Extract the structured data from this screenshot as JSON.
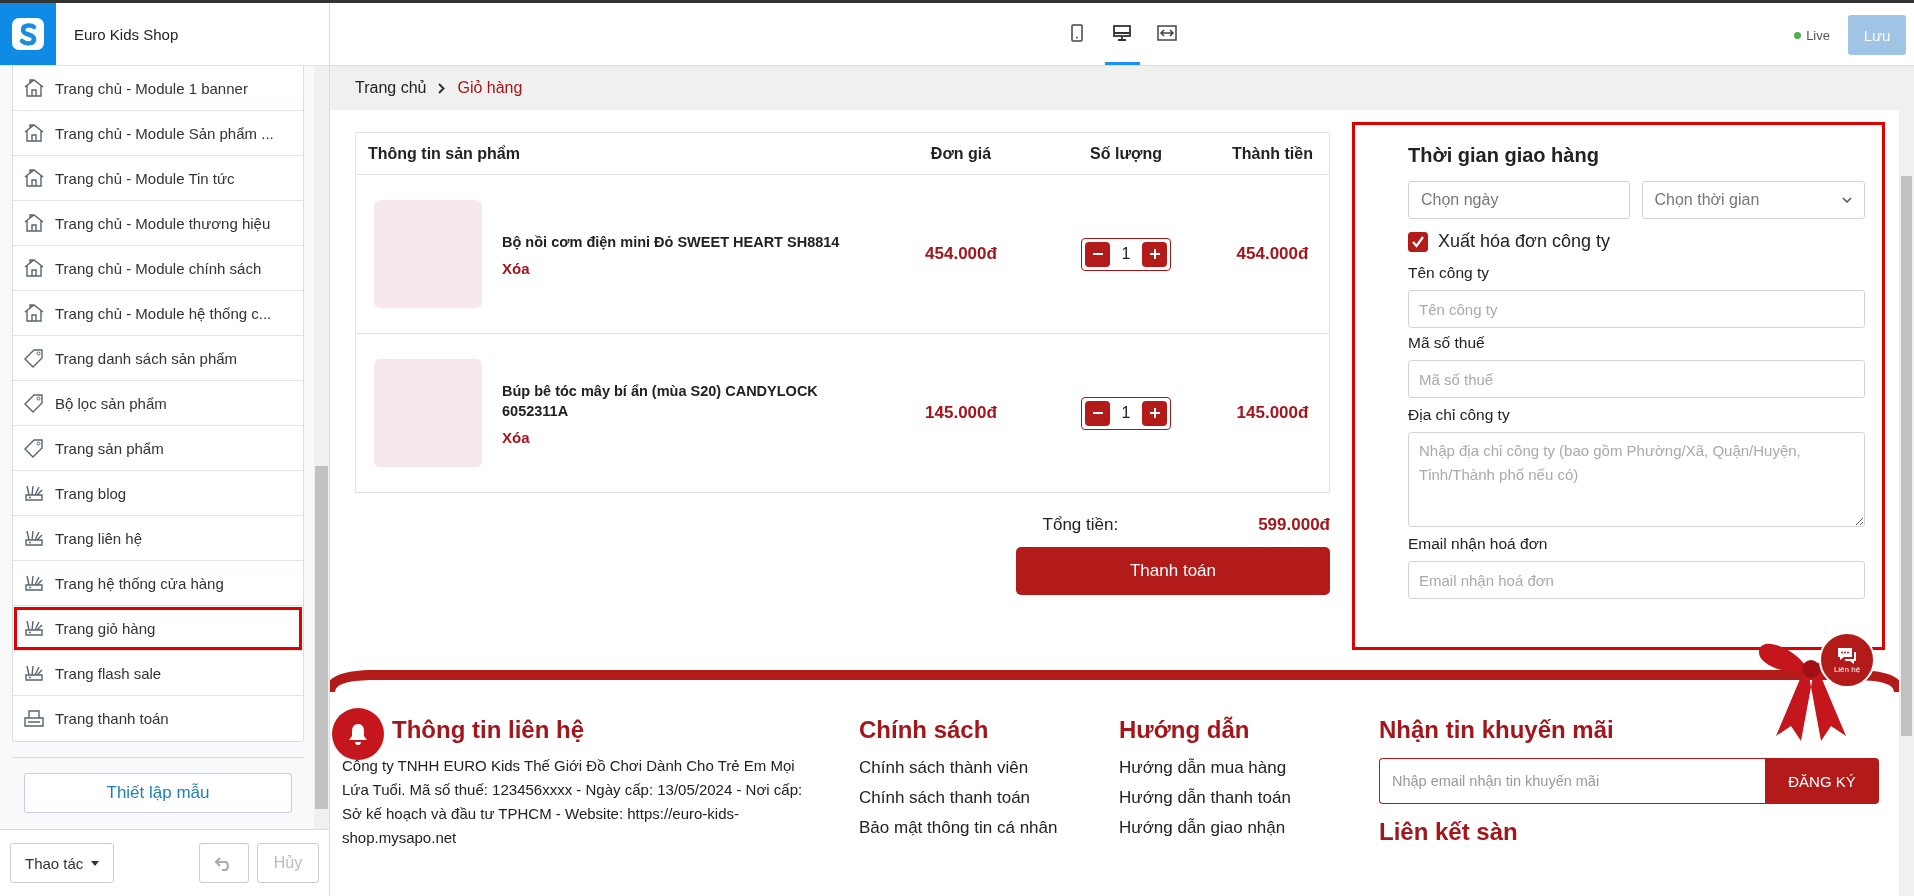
{
  "app": {
    "shop_name": "Euro Kids Shop"
  },
  "sidebar": {
    "items": [
      {
        "label": "Trang chủ - Module 1 banner",
        "kind": "home",
        "highlighted": false
      },
      {
        "label": "Trang chủ - Module Sản phẩm ...",
        "kind": "home",
        "highlighted": false
      },
      {
        "label": "Trang chủ - Module Tin tức",
        "kind": "home",
        "highlighted": false
      },
      {
        "label": "Trang chủ - Module thương hiệu",
        "kind": "home",
        "highlighted": false
      },
      {
        "label": "Trang chủ - Module chính sách",
        "kind": "home",
        "highlighted": false
      },
      {
        "label": "Trang chủ - Module hệ thống c...",
        "kind": "home",
        "highlighted": false
      },
      {
        "label": "Trang danh sách sản phẩm",
        "kind": "tag",
        "highlighted": false
      },
      {
        "label": "Bộ lọc sản phẩm",
        "kind": "tag",
        "highlighted": false
      },
      {
        "label": "Trang sản phẩm",
        "kind": "tag",
        "highlighted": false
      },
      {
        "label": "Trang blog",
        "kind": "brush",
        "highlighted": false
      },
      {
        "label": "Trang liên hệ",
        "kind": "brush",
        "highlighted": false
      },
      {
        "label": "Trang hệ thống cửa hàng",
        "kind": "brush",
        "highlighted": false
      },
      {
        "label": "Trang giỏ hàng",
        "kind": "brush",
        "highlighted": true
      },
      {
        "label": "Trang flash sale",
        "kind": "brush",
        "highlighted": false
      },
      {
        "label": "Trang thanh toán",
        "kind": "printer",
        "highlighted": false
      }
    ],
    "template_button": "Thiết lập mẫu",
    "actions_button": "Thao tác",
    "undo_disabled": true,
    "cancel": {
      "label": "Hủy",
      "disabled": true
    }
  },
  "toolbar": {
    "device_modes": [
      {
        "kind": "mobile",
        "selected": false
      },
      {
        "kind": "desktop",
        "selected": true
      },
      {
        "kind": "fullwidth",
        "selected": false
      }
    ],
    "status": "Live",
    "save": {
      "label": "Lưu",
      "disabled": true
    }
  },
  "breadcrumb": [
    {
      "label": "Trang chủ",
      "current": false
    },
    {
      "label": "Giỏ hàng",
      "current": true
    }
  ],
  "cart": {
    "columns": [
      "Thông tin sản phẩm",
      "Đơn giá",
      "Số lượng",
      "Thành tiền"
    ],
    "rows": [
      {
        "name": "Bộ nồi cơm điện mini Đỏ SWEET HEART SH8814",
        "remove": "Xóa",
        "price": "454.000đ",
        "quantity": "1",
        "total": "454.000đ"
      },
      {
        "name": "Búp bê tóc mây bí ẩn (mùa S20) CANDYLOCK 6052311A",
        "remove": "Xóa",
        "price": "145.000đ",
        "quantity": "1",
        "total": "145.000đ"
      }
    ],
    "total_label": "Tổng tiền:",
    "total": "599.000đ",
    "checkout": "Thanh toán"
  },
  "delivery": {
    "highlighted": true,
    "title": "Thời gian giao hàng",
    "date_placeholder": "Chọn ngày",
    "time_placeholder": "Chọn thời gian",
    "invoice": {
      "label": "Xuất hóa đơn công ty",
      "checked": true
    },
    "fields": [
      {
        "label": "Tên công ty",
        "placeholder": "Tên công ty",
        "kind": "input"
      },
      {
        "label": "Mã số thuế",
        "placeholder": "Mã số thuế",
        "kind": "input"
      },
      {
        "label": "Địa chỉ công ty",
        "placeholder": "Nhập địa chỉ công ty (bao gồm Phường/Xã, Quận/Huyện, Tỉnh/Thành phố nếu có)",
        "kind": "textarea"
      },
      {
        "label": "Email nhận hoá đơn",
        "placeholder": "Email nhận hoá đơn",
        "kind": "input"
      }
    ]
  },
  "footer": {
    "contact": {
      "title": "Thông tin liên hệ",
      "text": "Công ty TNHH EURO Kids Thế Giới Đồ Chơi Dành Cho Trẻ Em Mọi Lứa Tuổi. Mã số thuế: 123456xxxx - Ngày cấp: 13/05/2024 - Nơi cấp: Sở kế hoạch và đầu tư TPHCM - Website: https://euro-kids-shop.mysapo.net"
    },
    "link_columns": [
      {
        "title": "Chính sách",
        "links": [
          "Chính sách thành viên",
          "Chính sách thanh toán",
          "Bảo mật thông tin cá nhân"
        ]
      },
      {
        "title": "Hướng dẫn",
        "links": [
          "Hướng dẫn mua hàng",
          "Hướng dẫn thanh toán",
          "Hướng dẫn giao nhận"
        ]
      }
    ],
    "newsletter": {
      "title": "Nhận tin khuyến mãi",
      "placeholder": "Nhập email nhận tin khuyến mãi",
      "button": "ĐĂNG KÝ"
    },
    "marketplace_title": "Liên kết sàn",
    "contact_badge": "Liên hệ"
  }
}
